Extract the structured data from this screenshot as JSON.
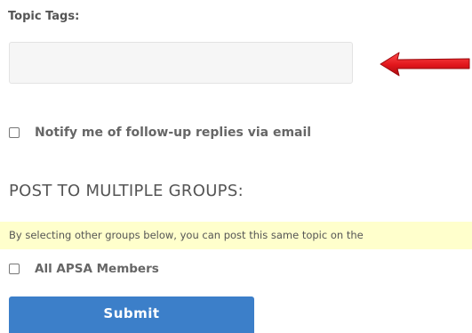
{
  "topic_tags": {
    "label": "Topic Tags:",
    "value": "",
    "placeholder": ""
  },
  "annotation": {
    "icon": "red-arrow-icon",
    "color": "#e0151b"
  },
  "notify": {
    "label": "Notify me of follow-up replies via email",
    "checked": false
  },
  "multiple_groups": {
    "heading": "POST TO MULTIPLE GROUPS:",
    "info_text": "By selecting other groups below, you can post this same topic on the",
    "info_bg_color": "#ffffcc",
    "groups": [
      {
        "label": "All APSA Members",
        "checked": false
      }
    ]
  },
  "submit": {
    "label": "Submit",
    "color": "#3c7fc9"
  }
}
